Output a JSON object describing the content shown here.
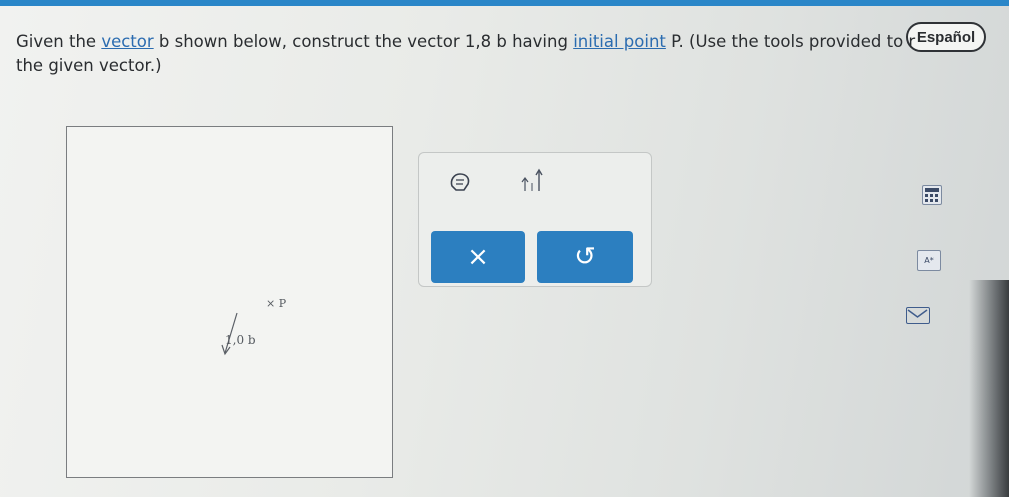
{
  "header": {
    "language_button": "Español"
  },
  "question": {
    "part1": "Given the ",
    "link_vector": "vector",
    "part2": " b shown below, construct the vector 1,8 b having ",
    "link_initial_point": "initial point",
    "part3": " P. (Use the tools provided to r",
    "line2": "the given vector.)"
  },
  "graph": {
    "vector_label": "1,0 b",
    "point_label": "P",
    "point_marker": "×"
  },
  "tools": {
    "clear_label": "×",
    "undo_label": "↺",
    "icons": [
      "eraser-hand-icon",
      "vector-tool-icon"
    ]
  },
  "side_panel": {
    "icons": [
      "calculator-icon",
      "font-size-icon",
      "mail-icon"
    ],
    "font_size_label": "A*"
  },
  "colors": {
    "accent": "#2c7fc0",
    "link": "#2b6cb0"
  }
}
